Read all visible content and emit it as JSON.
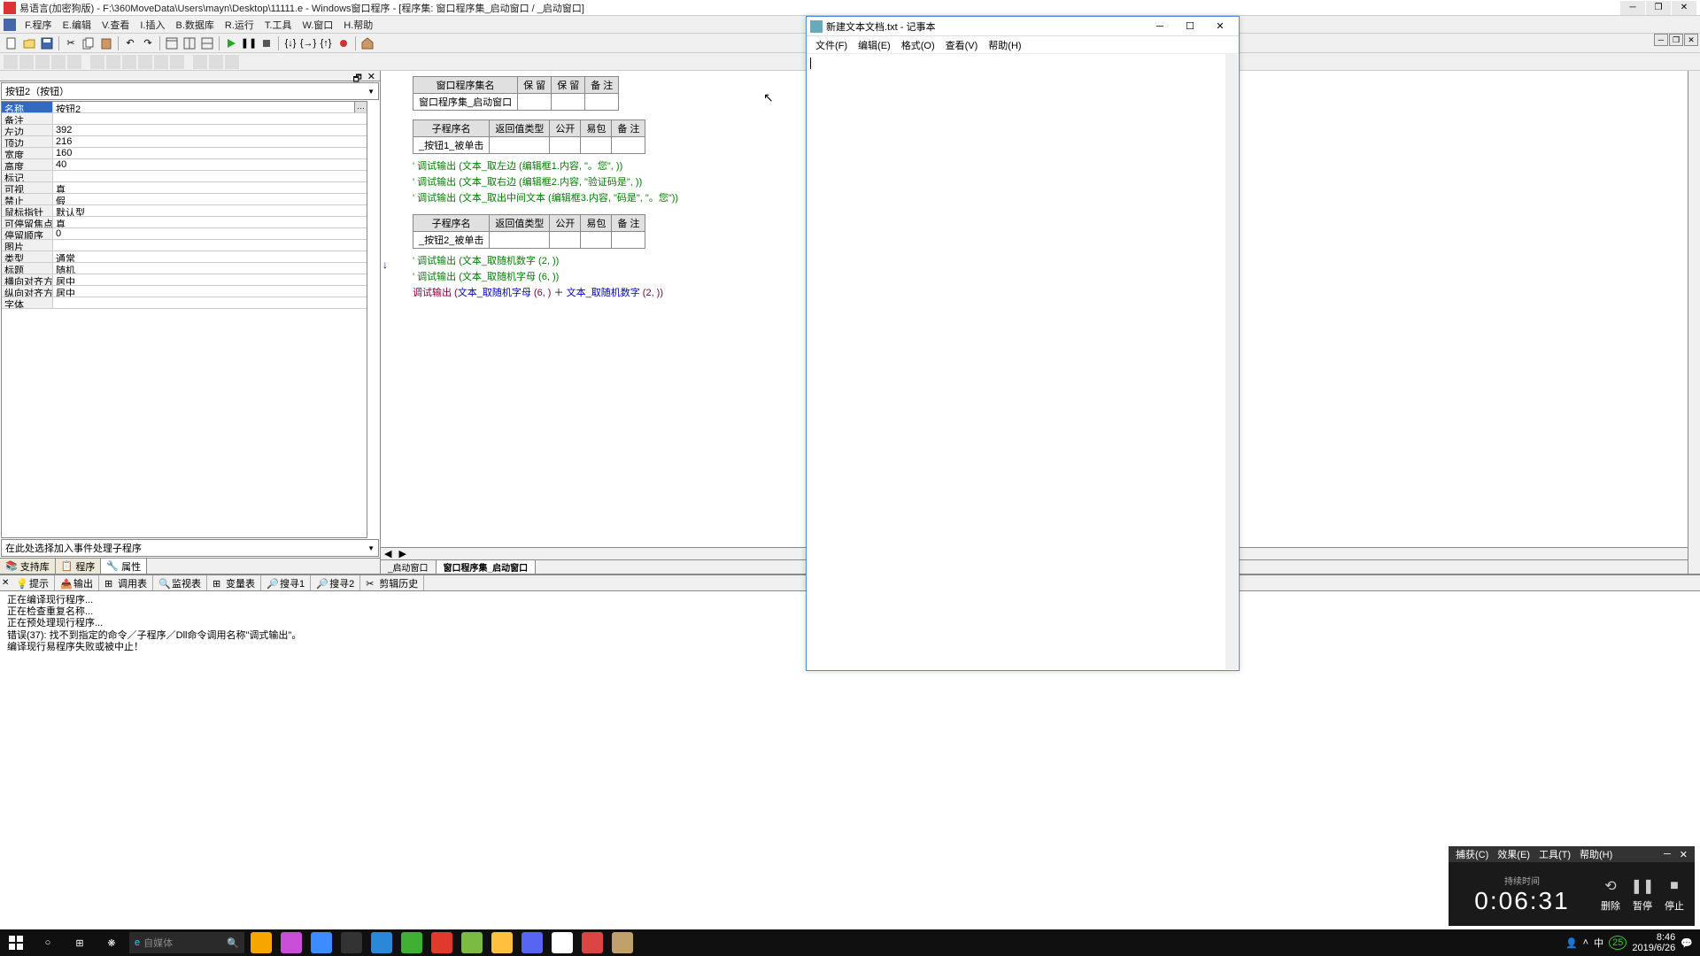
{
  "main": {
    "title": "易语言(加密狗版) - F:\\360MoveData\\Users\\mayn\\Desktop\\11111.e - Windows窗口程序 - [程序集: 窗口程序集_启动窗口 / _启动窗口]",
    "menu": [
      "F.程序",
      "E.编辑",
      "V.查看",
      "I.插入",
      "B.数据库",
      "R.运行",
      "T.工具",
      "W.窗口",
      "H.帮助"
    ]
  },
  "left": {
    "dropdown": "按钮2（按钮）",
    "props": [
      {
        "k": "名称",
        "v": "按钮2",
        "sel": true,
        "btn": true
      },
      {
        "k": "备注",
        "v": ""
      },
      {
        "k": "左边",
        "v": "392"
      },
      {
        "k": "顶边",
        "v": "216"
      },
      {
        "k": "宽度",
        "v": "160"
      },
      {
        "k": "高度",
        "v": "40"
      },
      {
        "k": "标记",
        "v": ""
      },
      {
        "k": "可视",
        "v": "真"
      },
      {
        "k": "禁止",
        "v": "假"
      },
      {
        "k": "鼠标指针",
        "v": "默认型"
      },
      {
        "k": "可停留焦点",
        "v": "真"
      },
      {
        "k": "  停留顺序",
        "v": "0"
      },
      {
        "k": "图片",
        "v": ""
      },
      {
        "k": "类型",
        "v": "通常"
      },
      {
        "k": "标题",
        "v": "随机"
      },
      {
        "k": "横向对齐方式",
        "v": "居中"
      },
      {
        "k": "纵向对齐方式",
        "v": "居中"
      },
      {
        "k": "字体",
        "v": ""
      }
    ],
    "events": "在此处选择加入事件处理子程序",
    "tabs": [
      "支持库",
      "程序",
      "属性"
    ],
    "activeTab": 2,
    "hdrBtns": [
      "🗗",
      "✕"
    ]
  },
  "code": {
    "t1": {
      "h": [
        "窗口程序集名",
        "保 留",
        "保 留",
        "备 注"
      ],
      "r": [
        "窗口程序集_启动窗口",
        "",
        "",
        ""
      ]
    },
    "t2": {
      "h": [
        "子程序名",
        "返回值类型",
        "公开",
        "易包",
        "备  注"
      ],
      "r": [
        "_按钮1_被单击",
        "",
        "",
        "",
        ""
      ]
    },
    "block1": [
      "' 调试输出 (文本_取左边 (编辑框1.内容, \"。您\", ))",
      "' 调试输出 (文本_取右边 (编辑框2.内容, \"验证码是\", ))",
      "' 调试输出 (文本_取出中间文本 (编辑框3.内容, \"码是\", \"。您\"))"
    ],
    "t3": {
      "h": [
        "子程序名",
        "返回值类型",
        "公开",
        "易包",
        "备  注"
      ],
      "r": [
        "_按钮2_被单击",
        "",
        "",
        "",
        ""
      ]
    },
    "block2": [
      "' 调试输出 (文本_取随机数字 (2, ))",
      "' 调试输出 (文本_取随机字母 (6, ))"
    ],
    "line3": {
      "pre": "调试输出 (",
      "f1": "文本_取随机字母",
      "a1": " (6, )",
      "op": " ＋ ",
      "f2": "文本_取随机数字",
      "a2": " (2, )",
      ")": ")"
    },
    "tabs": [
      "_启动窗口",
      "窗口程序集_启动窗口"
    ],
    "activeTab": 1
  },
  "bottom": {
    "tabs": [
      "提示",
      "输出",
      "调用表",
      "监视表",
      "变量表",
      "搜寻1",
      "搜寻2",
      "剪辑历史"
    ],
    "lines": [
      "正在编译现行程序...",
      "正在检查重复名称...",
      "正在预处理现行程序...",
      "错误(37): 找不到指定的命令／子程序／Dll命令调用名称\"调式输出\"。",
      "编译现行易程序失败或被中止！"
    ]
  },
  "notepad": {
    "title": "新建文本文档.txt - 记事本",
    "menu": [
      "文件(F)",
      "编辑(E)",
      "格式(O)",
      "查看(V)",
      "帮助(H)"
    ]
  },
  "recorder": {
    "menu": [
      "捕获(C)",
      "效果(E)",
      "工具(T)",
      "帮助(H)"
    ],
    "timeLabel": "持续时间",
    "time": "0:06:31",
    "btns": [
      {
        "l": "删除",
        "i": "⟲"
      },
      {
        "l": "暂停",
        "i": "❚❚"
      },
      {
        "l": "停止",
        "i": "■"
      }
    ]
  },
  "taskbar": {
    "search": "自媒体",
    "apps": [
      {
        "c": "#f7a500"
      },
      {
        "c": "#c94fd8"
      },
      {
        "c": "#3c8cff"
      },
      {
        "c": "#333"
      },
      {
        "c": "#2b88d8"
      },
      {
        "c": "#3eb135"
      },
      {
        "c": "#e03a2f"
      },
      {
        "c": "#7bbb44"
      },
      {
        "c": "#ffbf3f"
      },
      {
        "c": "#5865f2"
      },
      {
        "c": "#ffffff"
      },
      {
        "c": "#d44"
      },
      {
        "c": "#c0a16b"
      }
    ],
    "tray": {
      "time": "8:46",
      "date": "2019/6/26",
      "badge": "25"
    }
  }
}
